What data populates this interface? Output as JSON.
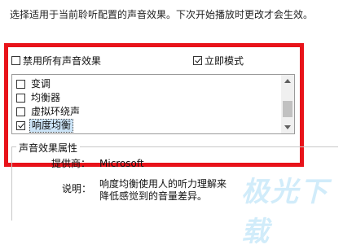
{
  "intro_text": "选择适用于当前聆听配置的声音效果。下次开始播放时更改才会生效。",
  "options": {
    "disable_all": {
      "label": "禁用所有声音效果",
      "checked": false
    },
    "immediate_mode": {
      "label": "立即模式",
      "checked": true
    }
  },
  "effects": [
    {
      "label": "变调",
      "checked": false,
      "selected": false
    },
    {
      "label": "均衡器",
      "checked": false,
      "selected": false
    },
    {
      "label": "虚拟环绕声",
      "checked": false,
      "selected": false
    },
    {
      "label": "响度均衡",
      "checked": true,
      "selected": true
    }
  ],
  "properties": {
    "title": "声音效果属性",
    "provider_label": "提供商：",
    "provider_value": "Microsoft",
    "description_label": "说明：",
    "description_value": "响度均衡使用人的听力理解来降低感觉到的音量差异。"
  },
  "watermark_text": "极光下载",
  "colors": {
    "highlight_border": "#e8131a",
    "selection": "#cce4f7"
  }
}
